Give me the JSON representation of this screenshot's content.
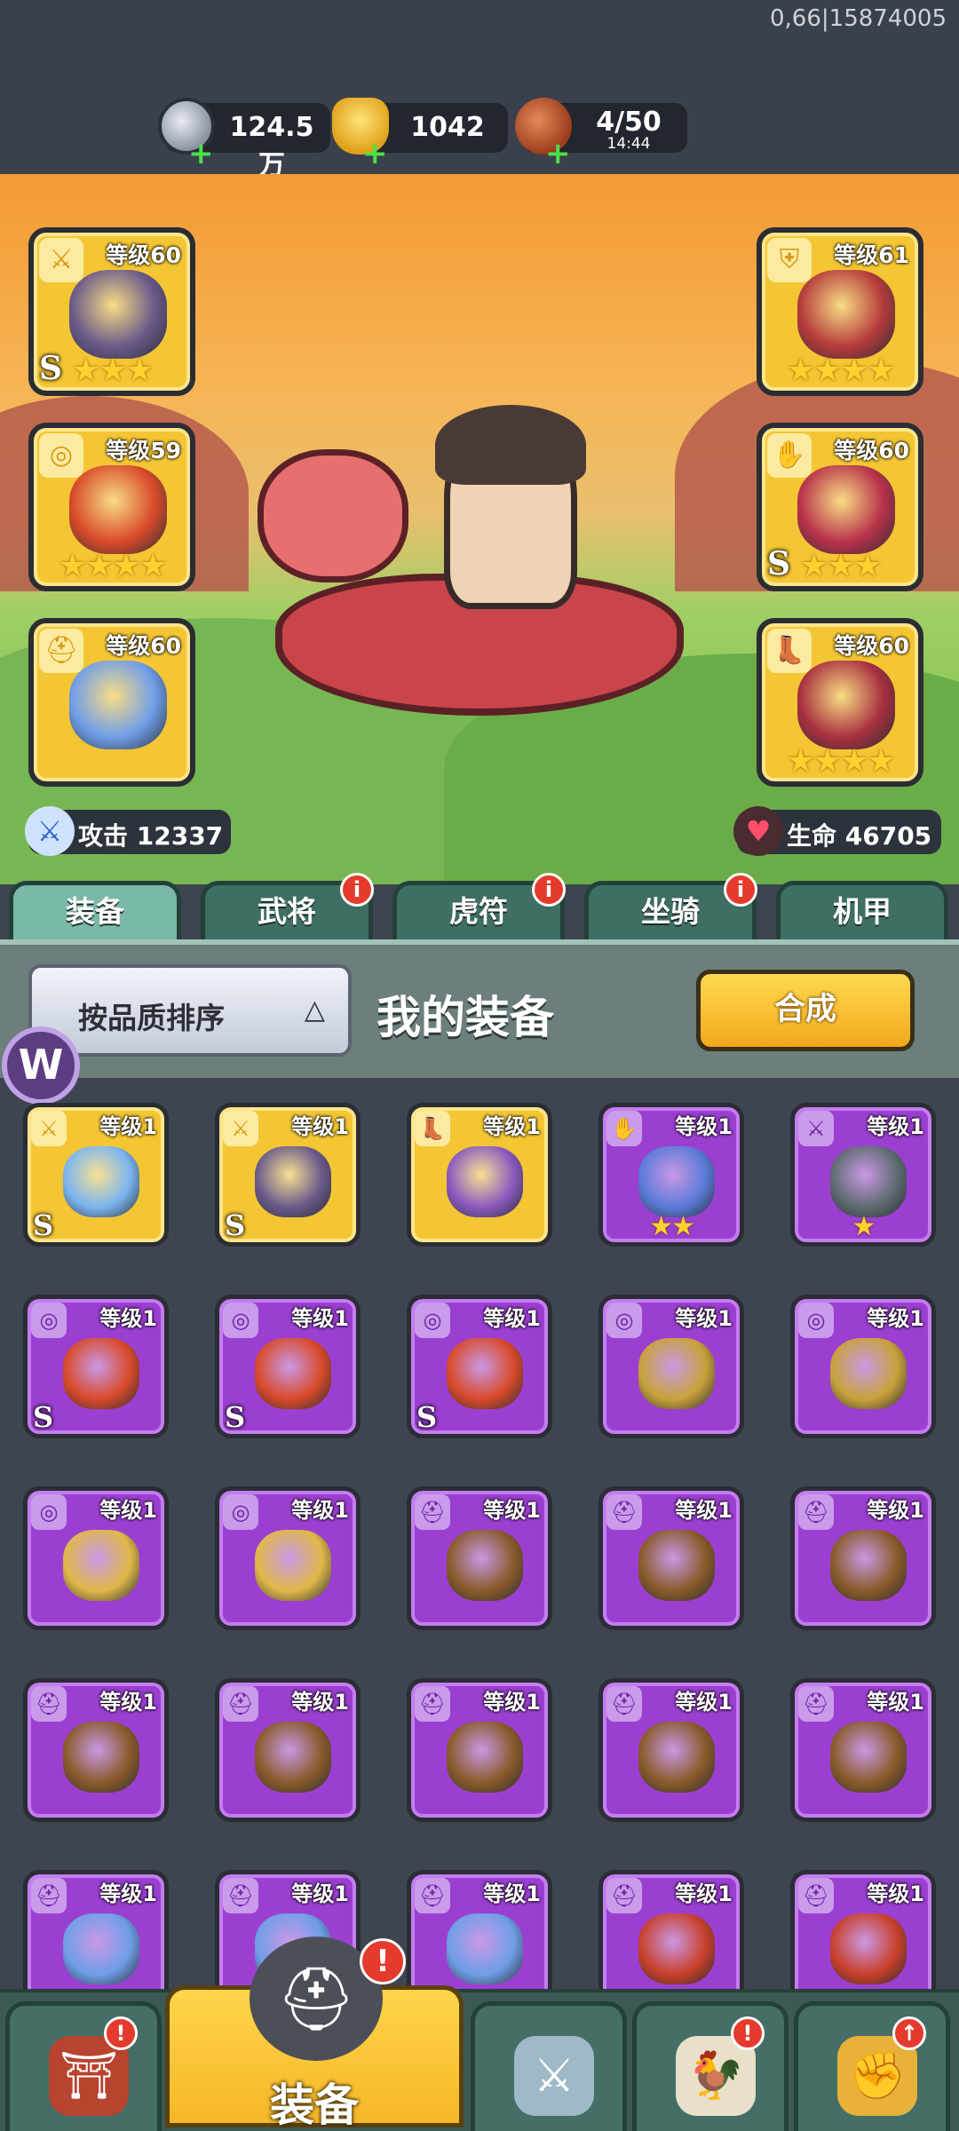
{
  "status": {
    "build_id": "0,66|15874005"
  },
  "resources": {
    "silver": {
      "icon": "silver-coin-icon",
      "value": "124.5万"
    },
    "gold": {
      "icon": "gold-ingot-icon",
      "value": "1042"
    },
    "stamina": {
      "icon": "meat-icon",
      "value": "4/50",
      "timer": "14:44"
    }
  },
  "hero": {
    "equipment": [
      {
        "slot": "weapon",
        "level": "等级60",
        "grade": "S",
        "stars": "★★★",
        "type_glyph": "⚔",
        "color": "#6a5a8a"
      },
      {
        "slot": "armor",
        "level": "等级61",
        "grade": "",
        "stars": "★★★★",
        "type_glyph": "⛨",
        "color": "#b53b3b"
      },
      {
        "slot": "accessory",
        "level": "等级59",
        "grade": "",
        "stars": "★★★★",
        "type_glyph": "◎",
        "color": "#d94a2a"
      },
      {
        "slot": "gloves",
        "level": "等级60",
        "grade": "S",
        "stars": "★★★",
        "type_glyph": "✋",
        "color": "#b8324a"
      },
      {
        "slot": "helmet",
        "level": "等级60",
        "grade": "",
        "stars": "",
        "type_glyph": "⛑",
        "color": "#6f9ee8"
      },
      {
        "slot": "boots",
        "level": "等级60",
        "grade": "",
        "stars": "★★★★",
        "type_glyph": "👢",
        "color": "#a8303f"
      }
    ],
    "attack": "攻击 12337",
    "hp": "生命 46705"
  },
  "tabs": [
    {
      "label": "装备",
      "active": true,
      "badge": ""
    },
    {
      "label": "武将",
      "active": false,
      "badge": "i"
    },
    {
      "label": "虎符",
      "active": false,
      "badge": "i"
    },
    {
      "label": "坐骑",
      "active": false,
      "badge": "i"
    },
    {
      "label": "机甲",
      "active": false,
      "badge": ""
    }
  ],
  "sortbar": {
    "sort_label": "按品质排序",
    "sort_arrow": "△",
    "title": "我的装备",
    "merge_label": "合成"
  },
  "inventory": [
    {
      "level": "等级1",
      "quality": "gold",
      "type_glyph": "⚔",
      "grade": "S",
      "stars": "",
      "color": "#7ab5f0"
    },
    {
      "level": "等级1",
      "quality": "gold",
      "type_glyph": "⚔",
      "grade": "S",
      "stars": "",
      "color": "#6a5a8a"
    },
    {
      "level": "等级1",
      "quality": "gold",
      "type_glyph": "👢",
      "grade": "",
      "stars": "",
      "color": "#8a5ac0"
    },
    {
      "level": "等级1",
      "quality": "purple",
      "type_glyph": "✋",
      "grade": "",
      "stars": "★★",
      "color": "#5a7ad8"
    },
    {
      "level": "等级1",
      "quality": "purple",
      "type_glyph": "⚔",
      "grade": "",
      "stars": "★",
      "color": "#5e6b70"
    },
    {
      "level": "等级1",
      "quality": "purple",
      "type_glyph": "◎",
      "grade": "S",
      "stars": "",
      "color": "#d94a2a"
    },
    {
      "level": "等级1",
      "quality": "purple",
      "type_glyph": "◎",
      "grade": "S",
      "stars": "",
      "color": "#d94a2a"
    },
    {
      "level": "等级1",
      "quality": "purple",
      "type_glyph": "◎",
      "grade": "S",
      "stars": "",
      "color": "#d94a2a"
    },
    {
      "level": "等级1",
      "quality": "purple",
      "type_glyph": "◎",
      "grade": "",
      "stars": "",
      "color": "#c9a23a"
    },
    {
      "level": "等级1",
      "quality": "purple",
      "type_glyph": "◎",
      "grade": "",
      "stars": "",
      "color": "#c9a23a"
    },
    {
      "level": "等级1",
      "quality": "purple",
      "type_glyph": "◎",
      "grade": "",
      "stars": "",
      "color": "#e0b848"
    },
    {
      "level": "等级1",
      "quality": "purple",
      "type_glyph": "◎",
      "grade": "",
      "stars": "",
      "color": "#e0b848"
    },
    {
      "level": "等级1",
      "quality": "purple",
      "type_glyph": "⛑",
      "grade": "",
      "stars": "",
      "color": "#8a5a2a"
    },
    {
      "level": "等级1",
      "quality": "purple",
      "type_glyph": "⛑",
      "grade": "",
      "stars": "",
      "color": "#8a5a2a"
    },
    {
      "level": "等级1",
      "quality": "purple",
      "type_glyph": "⛑",
      "grade": "",
      "stars": "",
      "color": "#8a5a2a"
    },
    {
      "level": "等级1",
      "quality": "purple",
      "type_glyph": "⛑",
      "grade": "",
      "stars": "",
      "color": "#8a5a2a"
    },
    {
      "level": "等级1",
      "quality": "purple",
      "type_glyph": "⛑",
      "grade": "",
      "stars": "",
      "color": "#8a5a2a"
    },
    {
      "level": "等级1",
      "quality": "purple",
      "type_glyph": "⛑",
      "grade": "",
      "stars": "",
      "color": "#8a5a2a"
    },
    {
      "level": "等级1",
      "quality": "purple",
      "type_glyph": "⛑",
      "grade": "",
      "stars": "",
      "color": "#8a5a2a"
    },
    {
      "level": "等级1",
      "quality": "purple",
      "type_glyph": "⛑",
      "grade": "",
      "stars": "",
      "color": "#8a5a2a"
    },
    {
      "level": "等级1",
      "quality": "purple",
      "type_glyph": "⛑",
      "grade": "",
      "stars": "",
      "color": "#6f9ee8"
    },
    {
      "level": "等级1",
      "quality": "purple",
      "type_glyph": "⛑",
      "grade": "",
      "stars": "",
      "color": "#6f9ee8"
    },
    {
      "level": "等级1",
      "quality": "purple",
      "type_glyph": "⛑",
      "grade": "",
      "stars": "",
      "color": "#6f9ee8"
    },
    {
      "level": "等级1",
      "quality": "purple",
      "type_glyph": "⛑",
      "grade": "",
      "stars": "",
      "color": "#c9402a"
    },
    {
      "level": "等级1",
      "quality": "purple",
      "type_glyph": "⛑",
      "grade": "",
      "stars": "",
      "color": "#c9402a"
    }
  ],
  "bottom_nav": [
    {
      "name": "gate",
      "icon": "gate-icon",
      "glyph": "⛩",
      "label": "",
      "badge": "!",
      "active": false
    },
    {
      "name": "equipment",
      "icon": "helmet-icon",
      "glyph": "⛑",
      "label": "装备",
      "badge": "!",
      "active": true
    },
    {
      "name": "battle",
      "icon": "crossed-swords-icon",
      "glyph": "⚔",
      "label": "",
      "badge": "",
      "active": false
    },
    {
      "name": "chicken",
      "icon": "rooster-icon",
      "glyph": "🐓",
      "label": "",
      "badge": "!",
      "active": false
    },
    {
      "name": "upgrade",
      "icon": "fist-upgrade-icon",
      "glyph": "✊",
      "label": "",
      "badge": "↑",
      "active": false
    }
  ],
  "overlay": {
    "logo_text": "W"
  }
}
